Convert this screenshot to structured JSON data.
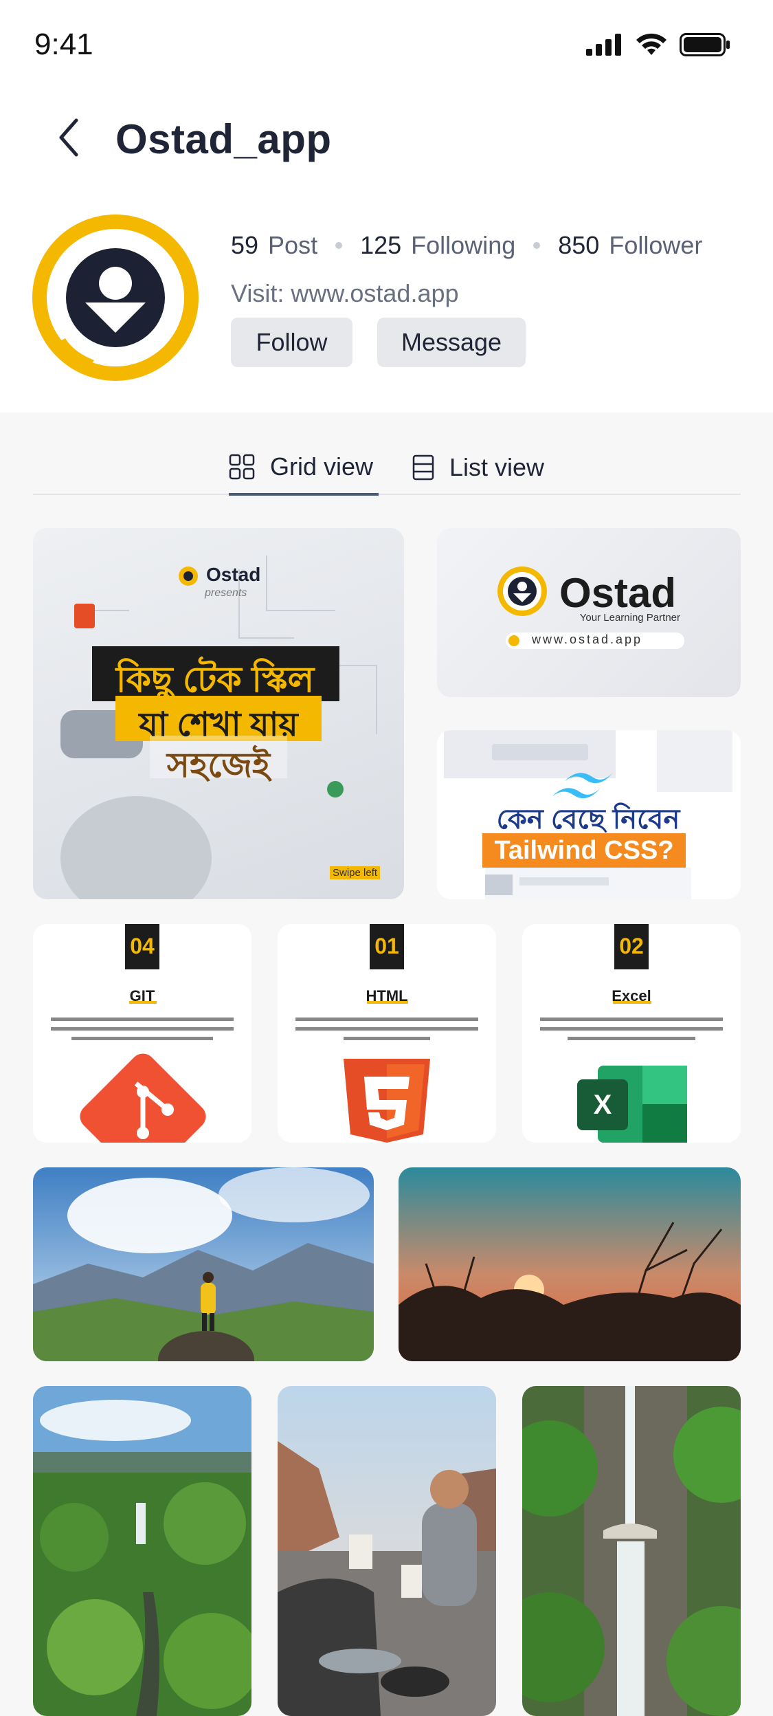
{
  "status_bar": {
    "time": "9:41",
    "icons": [
      "signal-icon",
      "wifi-icon",
      "battery-icon"
    ]
  },
  "header": {
    "title": "Ostad_app",
    "back_icon": "chevron-left-icon"
  },
  "profile": {
    "posts_count": "59",
    "posts_label": "Post",
    "following_count": "125",
    "following_label": "Following",
    "followers_count": "850",
    "followers_label": "Follower",
    "visit": "Visit: www.ostad.app",
    "follow_label": "Follow",
    "message_label": "Message"
  },
  "tabs": [
    {
      "label": "Grid view",
      "icon": "grid-icon",
      "active": true
    },
    {
      "label": "List view",
      "icon": "list-icon",
      "active": false
    }
  ],
  "posts": {
    "post1": {
      "brand": "Ostad",
      "presents": "presents",
      "headline_1": "কিছু টেক স্কিল",
      "headline_2": "যা শেখা যায়",
      "headline_3": "সহজেই",
      "swipe": "Swipe left"
    },
    "post2": {
      "brand": "Ostad",
      "tagline": "Your Learning Partner",
      "url": "www.ostad.app"
    },
    "post3": {
      "line_1": "কেন বেছে নিবেন",
      "line_2": "Tailwind CSS?"
    },
    "post4": {
      "number": "04",
      "title": "GIT"
    },
    "post5": {
      "number": "01",
      "title": "HTML"
    },
    "post6": {
      "number": "02",
      "title": "Excel"
    }
  },
  "colors": {
    "brand_yellow": "#f5b800",
    "brand_dark": "#1c2233",
    "tab_underline": "#4a5a7a",
    "button_bg": "#e7e8ec",
    "content_bg": "#f7f7f8"
  }
}
